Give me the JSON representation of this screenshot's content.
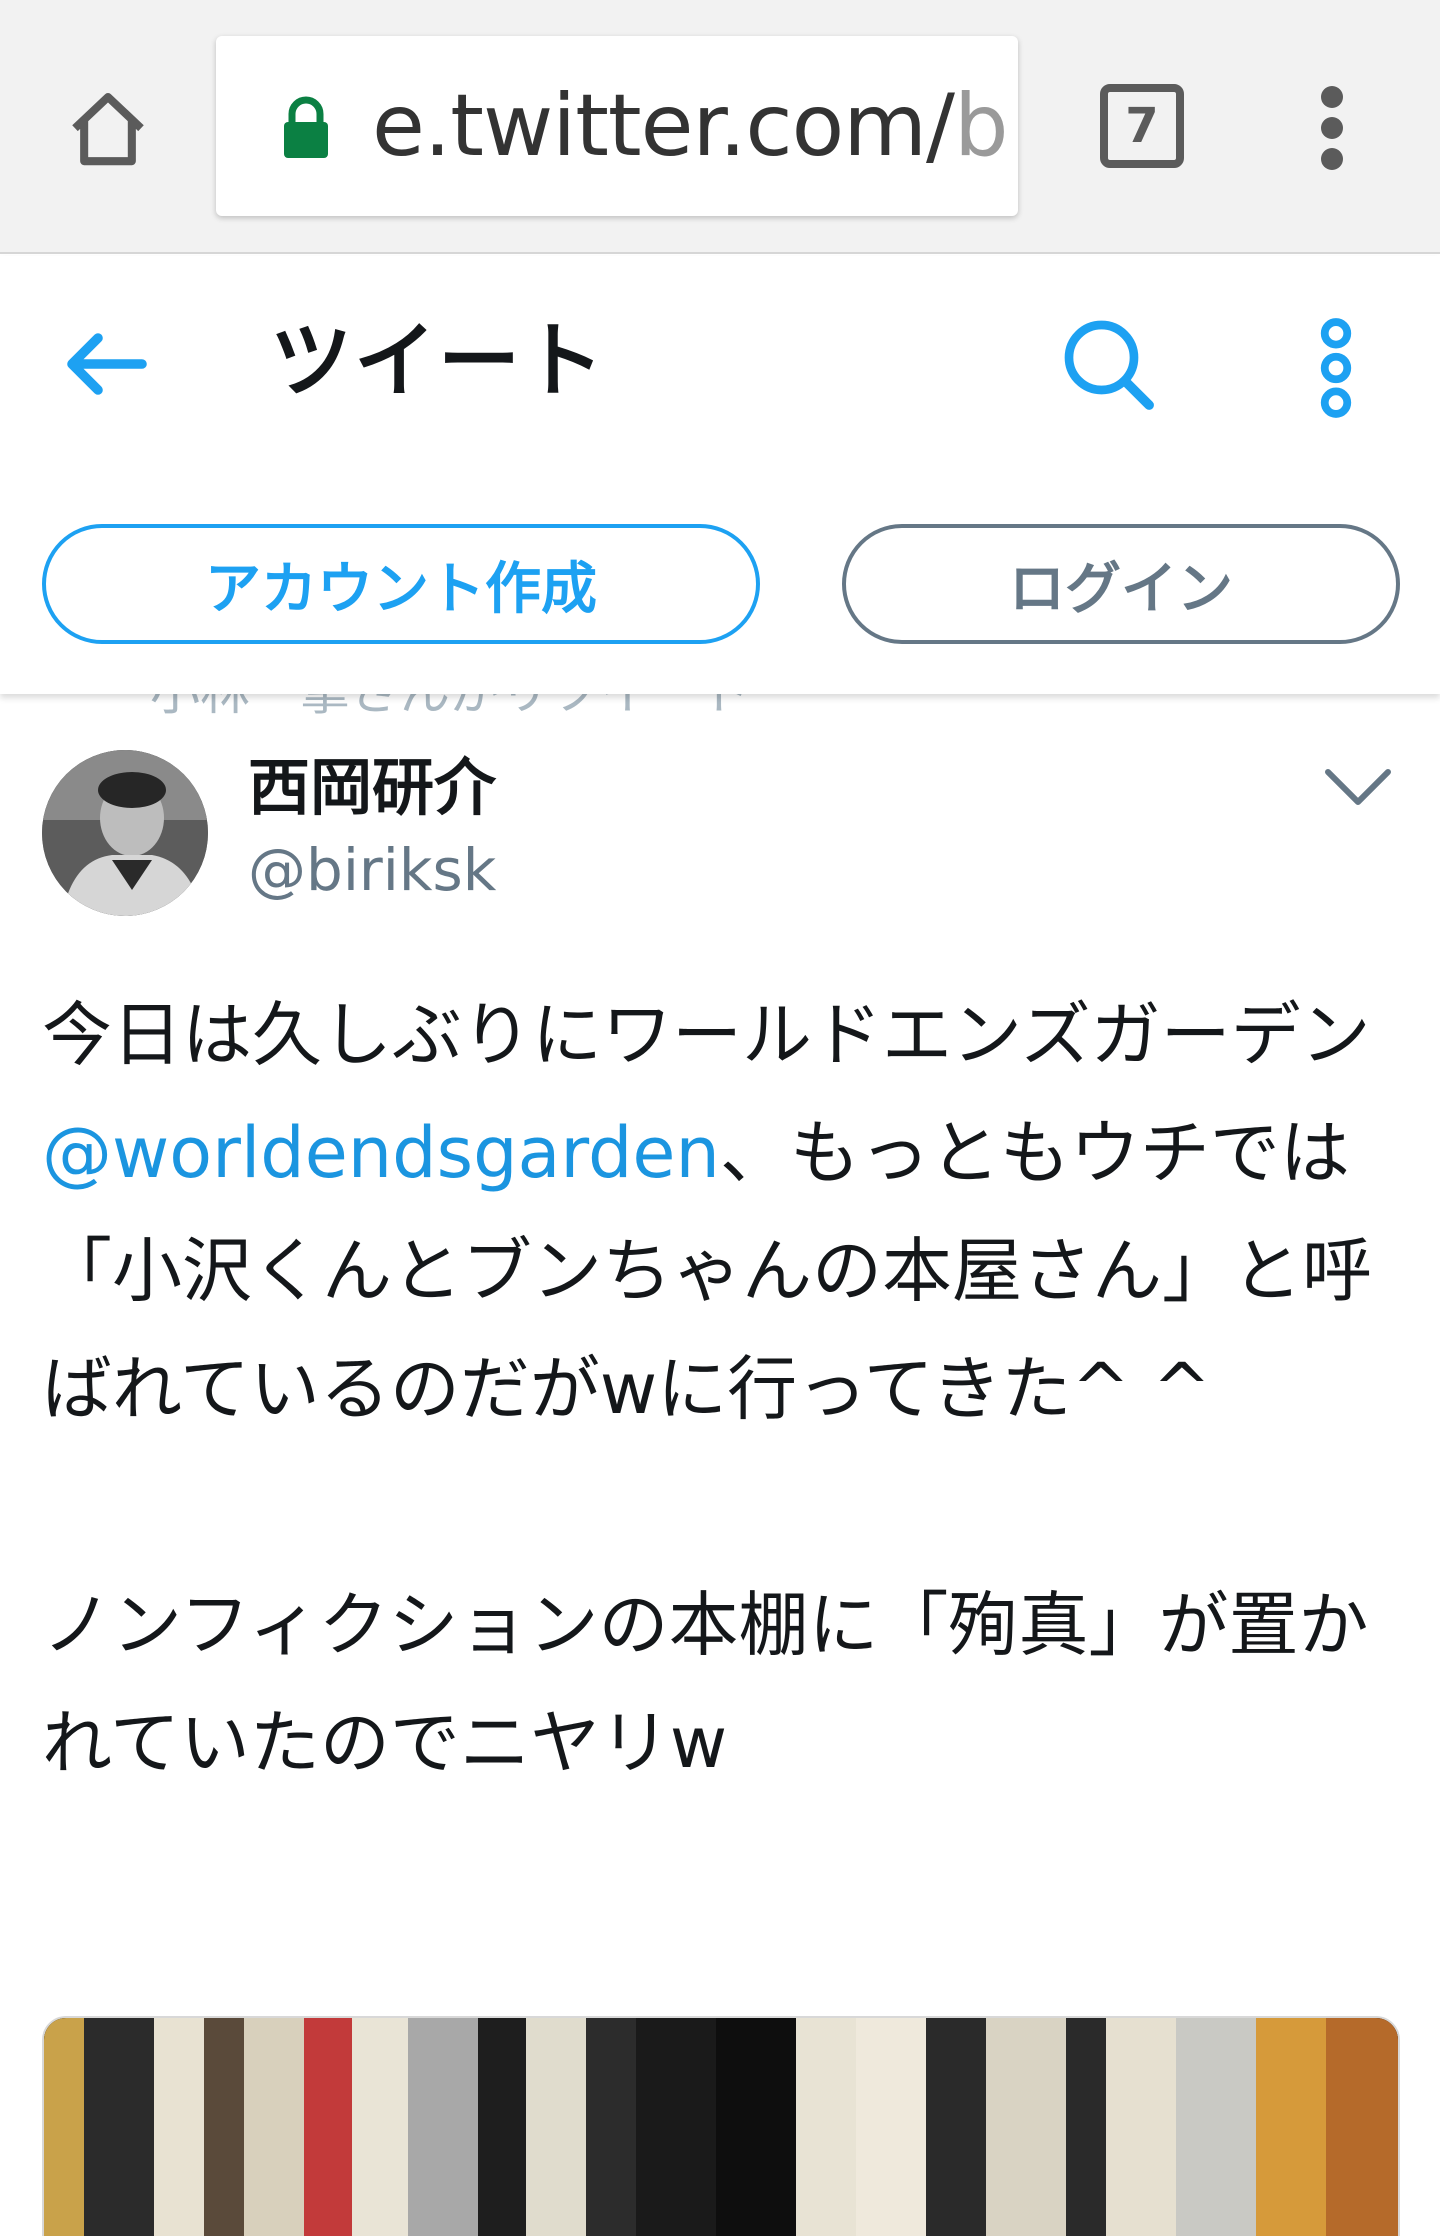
{
  "browser": {
    "url_main": "e.twitter.com/",
    "url_fade": "b",
    "tab_count": "7",
    "icons": {
      "home": "home-icon",
      "lock": "lock-icon",
      "tabs": "tab-switcher-icon",
      "menu": "overflow-menu-icon"
    }
  },
  "header": {
    "title": "ツイート",
    "signup_label": "アカウント作成",
    "login_label": "ログイン",
    "icons": {
      "back": "back-arrow-icon",
      "search": "search-icon",
      "more": "more-vertical-icon"
    }
  },
  "retweet_hint": "小林一掌さんがリツイート",
  "tweet": {
    "author_name": "西岡研介",
    "author_handle": "@biriksk",
    "text_before": "今日は久しぶりにワールドエンズガーデン",
    "mention": "@worldendsgarden",
    "text_after": "、もっともウチでは「小沢くんとブンちゃんの本屋さん」と呼ばれているのだがwに行ってきた^ ^\n\nノンフィクションの本棚に「殉真」が置かれていたのでニヤリw"
  },
  "colors": {
    "accent": "#1da1f2",
    "mention": "#1b95e0",
    "secondary": "#657786",
    "lock": "#0b8043"
  }
}
